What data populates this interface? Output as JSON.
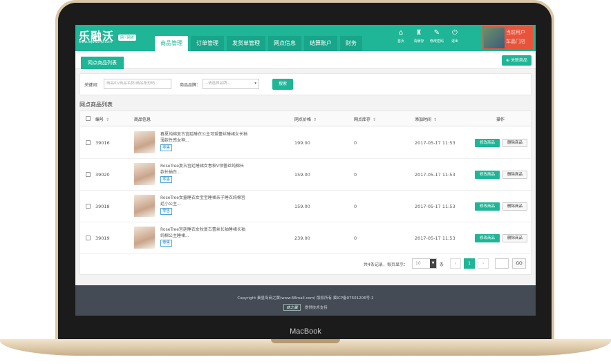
{
  "device": {
    "label": "MacBook"
  },
  "header": {
    "logo_text": "乐融沃",
    "logo_sub": "www.lejuwohp.com",
    "logo_badge": "网 · 网点",
    "tabs": [
      {
        "label": "商品管理",
        "active": true
      },
      {
        "label": "订单管理"
      },
      {
        "label": "发货单管理"
      },
      {
        "label": "网点信息"
      },
      {
        "label": "结算账户"
      },
      {
        "label": "财务"
      }
    ],
    "shortcuts": [
      {
        "icon": "home-icon",
        "glyph": "⌂",
        "label": "首页"
      },
      {
        "icon": "clear-cache-icon",
        "glyph": "♜",
        "label": "清缓存"
      },
      {
        "icon": "wrench-icon",
        "glyph": "✎",
        "label": "修改密码"
      },
      {
        "icon": "power-icon",
        "glyph": "⏻",
        "label": "退出"
      }
    ],
    "user": {
      "line1": "当前用户",
      "line2": "车晶门店"
    }
  },
  "subbar": {
    "tab": "网点商品列表",
    "link_button": "关联商品"
  },
  "filter": {
    "keyword_label": "关键词：",
    "keyword_placeholder": "商品ID/商品名称/商品条形码",
    "brand_label": "商品品牌：",
    "brand_placeholder": "--请选择品牌--",
    "search_button": "搜索"
  },
  "list_title": "网点商品列表",
  "table": {
    "headers": {
      "id": "编号",
      "info": "商品信息",
      "price": "网点价格",
      "stock": "网点库存",
      "time": "添加时间",
      "ops": "操作"
    },
    "rows": [
      {
        "id": "39016",
        "name": "春夏纯棉复古宫廷睡衣公主可爱蕾丝睡裙女长袖薄款性感女神...",
        "tag": "零售",
        "price": "199.00",
        "stock": "0",
        "time": "2017-05-17 11:53",
        "edit": "修改商品",
        "del": "删除商品"
      },
      {
        "id": "39020",
        "name": "RoseTree复古宫廷睡裙女春秋V领蕾丝纯棉长款长袖白...",
        "tag": "零售",
        "price": "159.00",
        "stock": "0",
        "time": "2017-05-17 11:53",
        "edit": "修改商品",
        "del": "删除商品"
      },
      {
        "id": "39018",
        "name": "RoseTree女童睡衣女宝宝睡裙亲子睡衣纯棉宫廷小公主...",
        "tag": "零售",
        "price": "159.00",
        "stock": "0",
        "time": "2017-05-17 11:53",
        "edit": "修改商品",
        "del": "删除商品"
      },
      {
        "id": "39019",
        "name": "RoseTree宫廷睡衣女秋复古蕾丝长袖睡裙长袖纯棉公主睡裙...",
        "tag": "零售",
        "price": "239.00",
        "stock": "0",
        "time": "2017-05-17 11:53",
        "edit": "修改商品",
        "del": "删除商品"
      }
    ]
  },
  "pagination": {
    "summary": "共4条记录，每页显示：",
    "per_page": "10",
    "unit": "条",
    "prev": "‹",
    "current": "1",
    "next": "›",
    "go": "GO"
  },
  "footer": {
    "copyright": "Copyright 秦皇岛商之翼(www.68mall.com) 版权所有   冀ICP备07501206号-2",
    "logo": "商之翼",
    "support": "提供技术支持"
  },
  "colors": {
    "accent": "#1fb597",
    "user_box": "#e8533c",
    "footer": "#444b55"
  }
}
